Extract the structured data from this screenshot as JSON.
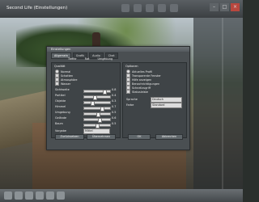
{
  "app": {
    "title": "Second Life (Einstellungen)"
  },
  "dialog": {
    "title": "Einstellungen",
    "tabs": [
      "Allgemein",
      "Grafik",
      "Audio",
      "Chat"
    ],
    "subtabs": [
      "Treffer",
      "Rat",
      "Umgebung"
    ],
    "left_panel": {
      "header": "Qualität",
      "rows": [
        {
          "type": "radio",
          "label": "Normal"
        },
        {
          "type": "checkbox",
          "label": "Schatten"
        },
        {
          "type": "checkbox",
          "label": "Atmosphäre"
        },
        {
          "type": "checkbox",
          "label": "Wasser"
        }
      ],
      "sliders": [
        {
          "label": "Sichtweite",
          "value": "0.8"
        },
        {
          "label": "Partikel",
          "value": "0.4"
        },
        {
          "label": "Objekte",
          "value": "0.3"
        },
        {
          "label": "Himmel",
          "value": "0.7"
        },
        {
          "label": "Umgebung",
          "value": "0.5"
        },
        {
          "label": "Gelände",
          "value": "0.6"
        },
        {
          "label": "Baum",
          "value": "0.5"
        }
      ],
      "buttons": [
        {
          "label": "Zurücksetzen"
        },
        {
          "label": "Übernehmen"
        }
      ],
      "dropdown_label": "Vorgabe",
      "dropdown_value": "Mittel"
    },
    "right_panel": {
      "header": "Optionen",
      "options": [
        {
          "type": "radio",
          "label": "Aktuelles Profil"
        },
        {
          "type": "checkbox",
          "label": "Transparente Fenster"
        },
        {
          "type": "checkbox",
          "label": "Hilfe anzeigen"
        },
        {
          "type": "checkbox",
          "label": "Benachrichtigungen"
        },
        {
          "type": "checkbox",
          "label": "Schnellzugriff"
        },
        {
          "type": "checkbox",
          "label": "Statusleiste"
        }
      ],
      "dropdowns": [
        {
          "label": "Sprache",
          "value": "Deutsch"
        },
        {
          "label": "Farbe",
          "value": "Standard"
        }
      ],
      "buttons": [
        {
          "label": "OK"
        },
        {
          "label": "Abbrechen"
        }
      ]
    }
  },
  "bottom": {
    "icons": [
      "home-icon",
      "chat-icon",
      "people-icon",
      "inventory-icon",
      "map-icon",
      "camera-icon"
    ]
  }
}
